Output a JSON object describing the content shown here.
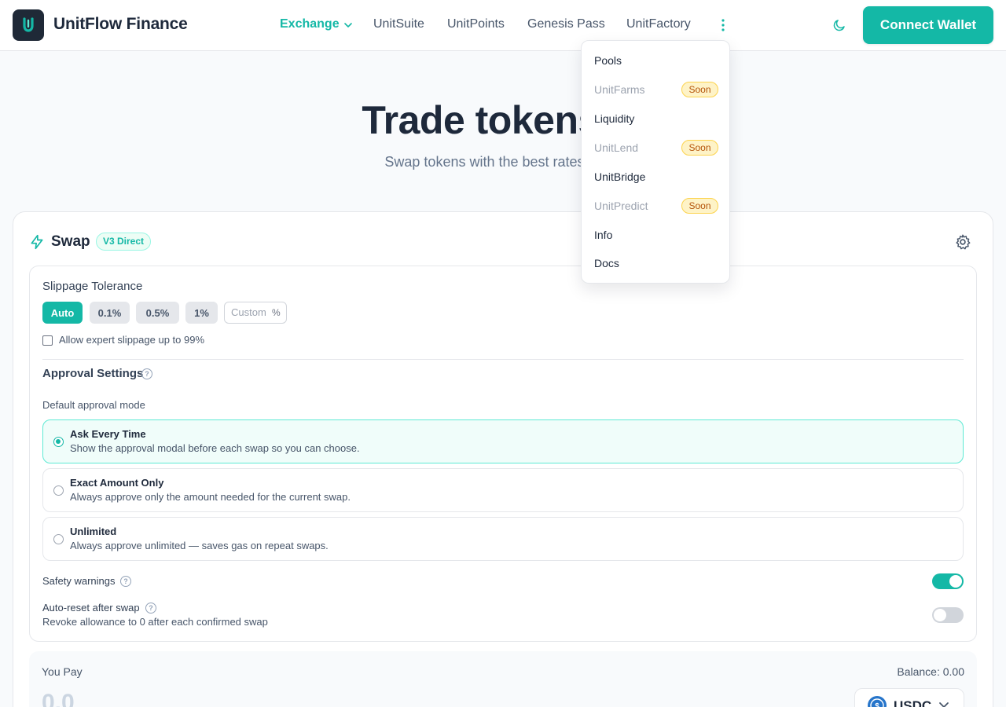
{
  "header": {
    "brand": "UnitFlow Finance",
    "nav": [
      {
        "label": "Exchange",
        "active": true
      },
      {
        "label": "UnitSuite"
      },
      {
        "label": "UnitPoints"
      },
      {
        "label": "Genesis Pass"
      },
      {
        "label": "UnitFactory"
      }
    ],
    "connect_label": "Connect Wallet",
    "more_icon": "more-vertical-icon",
    "theme_icon": "moon-icon"
  },
  "dropdown": {
    "items": [
      {
        "label": "Pools",
        "enabled": true
      },
      {
        "label": "UnitFarms",
        "badge": "Soon",
        "enabled": false
      },
      {
        "label": "Liquidity",
        "enabled": true
      },
      {
        "label": "UnitLend",
        "badge": "Soon",
        "enabled": false
      },
      {
        "label": "UnitBridge",
        "enabled": true
      },
      {
        "label": "UnitPredict",
        "badge": "Soon",
        "enabled": false
      },
      {
        "label": "Info",
        "enabled": true
      },
      {
        "label": "Docs",
        "enabled": true
      }
    ]
  },
  "hero": {
    "title_visible": "Trade tokens in",
    "subtitle_visible": "Swap tokens with the best rates on Ar"
  },
  "swap": {
    "title": "Swap",
    "badge": "V3 Direct",
    "settings": {
      "slippage_label": "Slippage Tolerance",
      "chips": [
        "Auto",
        "0.1%",
        "0.5%",
        "1%"
      ],
      "selected_chip": "Auto",
      "custom_placeholder": "Custom",
      "custom_suffix": "%",
      "expert_label": "Allow expert slippage up to 99%",
      "expert_checked": false,
      "approval_title": "Approval Settings",
      "default_mode_label": "Default approval mode",
      "options": [
        {
          "title": "Ask Every Time",
          "desc": "Show the approval modal before each swap so you can choose.",
          "selected": true
        },
        {
          "title": "Exact Amount Only",
          "desc": "Always approve only the amount needed for the current swap.",
          "selected": false
        },
        {
          "title": "Unlimited",
          "desc": "Always approve unlimited — saves gas on repeat swaps.",
          "selected": false
        }
      ],
      "safety_label": "Safety warnings",
      "safety_on": true,
      "reset_label": "Auto-reset after swap",
      "reset_desc": "Revoke allowance to 0 after each confirmed swap",
      "reset_on": false
    },
    "pay": {
      "label": "You Pay",
      "balance": "Balance: 0.00",
      "amount_placeholder": "0.0",
      "token": "USDC"
    }
  },
  "colors": {
    "accent": "#14b8a6",
    "text": "#1e293b",
    "soon_bg": "#fef3c7"
  }
}
